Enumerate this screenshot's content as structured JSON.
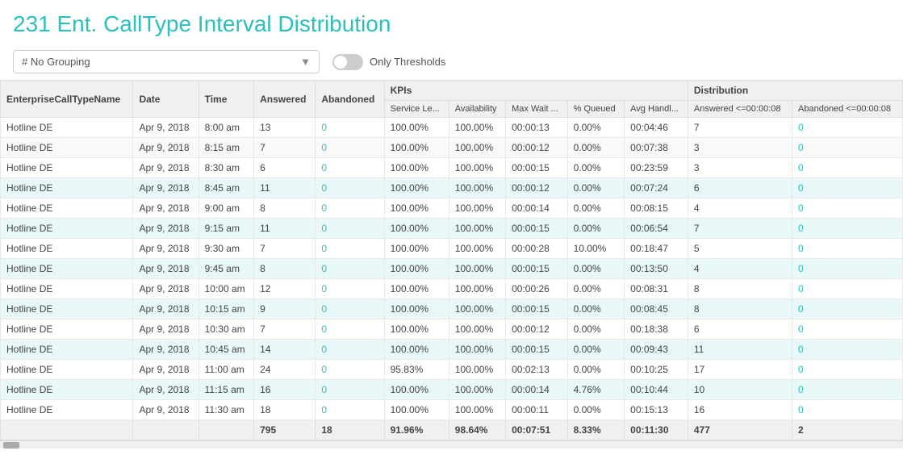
{
  "header": {
    "title": "231 Ent. CallType Interval Distribution"
  },
  "toolbar": {
    "grouping_label": "# No Grouping",
    "only_thresholds_label": "Only Thresholds",
    "toggle_active": false
  },
  "table": {
    "columns_top": [
      {
        "label": "EnterpriseCallTypeName",
        "rowspan": 2,
        "colspan": 1
      },
      {
        "label": "Date",
        "rowspan": 2,
        "colspan": 1
      },
      {
        "label": "Time",
        "rowspan": 2,
        "colspan": 1
      },
      {
        "label": "Answered",
        "rowspan": 2,
        "colspan": 1
      },
      {
        "label": "Abandoned",
        "rowspan": 2,
        "colspan": 1
      },
      {
        "label": "KPIs",
        "rowspan": 1,
        "colspan": 5
      },
      {
        "label": "Distribution",
        "rowspan": 1,
        "colspan": 2
      }
    ],
    "columns_sub": [
      {
        "label": "Service Le..."
      },
      {
        "label": "Availability"
      },
      {
        "label": "Max Wait ..."
      },
      {
        "label": "% Queued"
      },
      {
        "label": "Avg Handl..."
      },
      {
        "label": "Answered <=00:00:08"
      },
      {
        "label": "Abandoned <=00:00:08"
      }
    ],
    "rows": [
      {
        "name": "Hotline DE",
        "date": "Apr 9, 2018",
        "time": "8:00 am",
        "answered": "13",
        "abandoned": "0",
        "service_level": "100.00%",
        "availability": "100.00%",
        "max_wait": "00:00:13",
        "pct_queued": "0.00%",
        "avg_handle": "00:04:46",
        "ans_dist": "7",
        "abn_dist": "0",
        "highlight": false
      },
      {
        "name": "Hotline DE",
        "date": "Apr 9, 2018",
        "time": "8:15 am",
        "answered": "7",
        "abandoned": "0",
        "service_level": "100.00%",
        "availability": "100.00%",
        "max_wait": "00:00:12",
        "pct_queued": "0.00%",
        "avg_handle": "00:07:38",
        "ans_dist": "3",
        "abn_dist": "0",
        "highlight": false
      },
      {
        "name": "Hotline DE",
        "date": "Apr 9, 2018",
        "time": "8:30 am",
        "answered": "6",
        "abandoned": "0",
        "service_level": "100.00%",
        "availability": "100.00%",
        "max_wait": "00:00:15",
        "pct_queued": "0.00%",
        "avg_handle": "00:23:59",
        "ans_dist": "3",
        "abn_dist": "0",
        "highlight": false
      },
      {
        "name": "Hotline DE",
        "date": "Apr 9, 2018",
        "time": "8:45 am",
        "answered": "11",
        "abandoned": "0",
        "service_level": "100.00%",
        "availability": "100.00%",
        "max_wait": "00:00:12",
        "pct_queued": "0.00%",
        "avg_handle": "00:07:24",
        "ans_dist": "6",
        "abn_dist": "0",
        "highlight": true
      },
      {
        "name": "Hotline DE",
        "date": "Apr 9, 2018",
        "time": "9:00 am",
        "answered": "8",
        "abandoned": "0",
        "service_level": "100.00%",
        "availability": "100.00%",
        "max_wait": "00:00:14",
        "pct_queued": "0.00%",
        "avg_handle": "00:08:15",
        "ans_dist": "4",
        "abn_dist": "0",
        "highlight": false
      },
      {
        "name": "Hotline DE",
        "date": "Apr 9, 2018",
        "time": "9:15 am",
        "answered": "11",
        "abandoned": "0",
        "service_level": "100.00%",
        "availability": "100.00%",
        "max_wait": "00:00:15",
        "pct_queued": "0.00%",
        "avg_handle": "00:06:54",
        "ans_dist": "7",
        "abn_dist": "0",
        "highlight": true
      },
      {
        "name": "Hotline DE",
        "date": "Apr 9, 2018",
        "time": "9:30 am",
        "answered": "7",
        "abandoned": "0",
        "service_level": "100.00%",
        "availability": "100.00%",
        "max_wait": "00:00:28",
        "pct_queued": "10.00%",
        "avg_handle": "00:18:47",
        "ans_dist": "5",
        "abn_dist": "0",
        "highlight": false
      },
      {
        "name": "Hotline DE",
        "date": "Apr 9, 2018",
        "time": "9:45 am",
        "answered": "8",
        "abandoned": "0",
        "service_level": "100.00%",
        "availability": "100.00%",
        "max_wait": "00:00:15",
        "pct_queued": "0.00%",
        "avg_handle": "00:13:50",
        "ans_dist": "4",
        "abn_dist": "0",
        "highlight": true
      },
      {
        "name": "Hotline DE",
        "date": "Apr 9, 2018",
        "time": "10:00 am",
        "answered": "12",
        "abandoned": "0",
        "service_level": "100.00%",
        "availability": "100.00%",
        "max_wait": "00:00:26",
        "pct_queued": "0.00%",
        "avg_handle": "00:08:31",
        "ans_dist": "8",
        "abn_dist": "0",
        "highlight": false
      },
      {
        "name": "Hotline DE",
        "date": "Apr 9, 2018",
        "time": "10:15 am",
        "answered": "9",
        "abandoned": "0",
        "service_level": "100.00%",
        "availability": "100.00%",
        "max_wait": "00:00:15",
        "pct_queued": "0.00%",
        "avg_handle": "00:08:45",
        "ans_dist": "8",
        "abn_dist": "0",
        "highlight": true
      },
      {
        "name": "Hotline DE",
        "date": "Apr 9, 2018",
        "time": "10:30 am",
        "answered": "7",
        "abandoned": "0",
        "service_level": "100.00%",
        "availability": "100.00%",
        "max_wait": "00:00:12",
        "pct_queued": "0.00%",
        "avg_handle": "00:18:38",
        "ans_dist": "6",
        "abn_dist": "0",
        "highlight": false
      },
      {
        "name": "Hotline DE",
        "date": "Apr 9, 2018",
        "time": "10:45 am",
        "answered": "14",
        "abandoned": "0",
        "service_level": "100.00%",
        "availability": "100.00%",
        "max_wait": "00:00:15",
        "pct_queued": "0.00%",
        "avg_handle": "00:09:43",
        "ans_dist": "11",
        "abn_dist": "0",
        "highlight": true
      },
      {
        "name": "Hotline DE",
        "date": "Apr 9, 2018",
        "time": "11:00 am",
        "answered": "24",
        "abandoned": "0",
        "service_level": "95.83%",
        "availability": "100.00%",
        "max_wait": "00:02:13",
        "pct_queued": "0.00%",
        "avg_handle": "00:10:25",
        "ans_dist": "17",
        "abn_dist": "0",
        "highlight": false
      },
      {
        "name": "Hotline DE",
        "date": "Apr 9, 2018",
        "time": "11:15 am",
        "answered": "16",
        "abandoned": "0",
        "service_level": "100.00%",
        "availability": "100.00%",
        "max_wait": "00:00:14",
        "pct_queued": "4.76%",
        "avg_handle": "00:10:44",
        "ans_dist": "10",
        "abn_dist": "0",
        "highlight": true
      },
      {
        "name": "Hotline DE",
        "date": "Apr 9, 2018",
        "time": "11:30 am",
        "answered": "18",
        "abandoned": "0",
        "service_level": "100.00%",
        "availability": "100.00%",
        "max_wait": "00:00:11",
        "pct_queued": "0.00%",
        "avg_handle": "00:15:13",
        "ans_dist": "16",
        "abn_dist": "0",
        "highlight": false
      }
    ],
    "footer": {
      "answered_total": "795",
      "abandoned_total": "18",
      "service_level_total": "91.96%",
      "availability_total": "98.64%",
      "max_wait_total": "00:07:51",
      "pct_queued_total": "8.33%",
      "avg_handle_total": "00:11:30",
      "ans_dist_total": "477",
      "abn_dist_total": "2"
    }
  }
}
